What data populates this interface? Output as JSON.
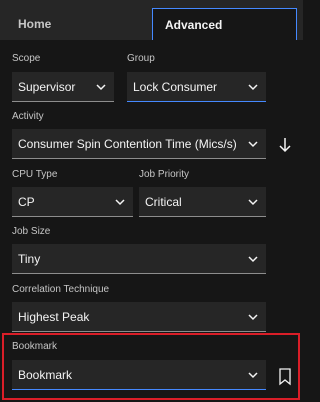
{
  "tabs": {
    "home": "Home",
    "advanced": "Advanced"
  },
  "scope": {
    "label": "Scope",
    "value": "Supervisor"
  },
  "group": {
    "label": "Group",
    "value": "Lock Consumer"
  },
  "activity": {
    "label": "Activity",
    "value": "Consumer Spin Contention Time (Mics/s)"
  },
  "cpu_type": {
    "label": "CPU Type",
    "value": "CP"
  },
  "job_priority": {
    "label": "Job Priority",
    "value": "Critical"
  },
  "job_size": {
    "label": "Job Size",
    "value": "Tiny"
  },
  "correlation": {
    "label": "Correlation Technique",
    "value": "Highest Peak"
  },
  "bookmark": {
    "label": "Bookmark",
    "value": "Bookmark"
  },
  "colors": {
    "background": "#161616",
    "field": "#262626",
    "accent": "#4589ff",
    "highlight": "#da1e28"
  },
  "icons": [
    "chevron-down-icon",
    "arrow-down-icon",
    "bookmark-icon"
  ]
}
